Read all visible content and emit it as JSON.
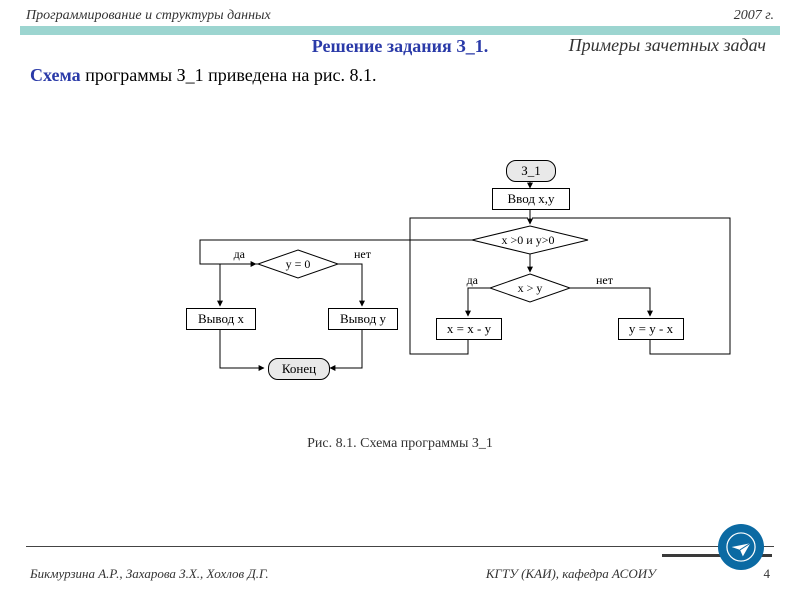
{
  "header": {
    "left": "Программирование и структуры данных",
    "right": "2007 г."
  },
  "section_title": "Примеры зачетных задач",
  "task_title": "Решение задания З_1.",
  "task_sentence_em": "Cхема",
  "task_sentence_rest": " программы З_1 приведена на рис. 8.1.",
  "flow": {
    "start": "З_1",
    "input": "Ввод x,y",
    "cond_main": "x >0 и y>0",
    "cond_yzero": "y = 0",
    "cond_xgty": "x > y",
    "yes": "да",
    "no": "нет",
    "out_x": "Вывод  x",
    "out_y": "Вывод  y",
    "assign_x": "x = x - y",
    "assign_y": "y = y - x",
    "end": "Конец"
  },
  "caption": "Рис. 8.1.  Схема программы З_1",
  "footer": {
    "authors": "Бикмурзина А.Р., Захарова З.Х., Хохлов Д.Г.",
    "uni": "КГТУ  (КАИ),   кафедра АСОИУ",
    "page": "4"
  },
  "icon_name": "paper-plane-icon"
}
